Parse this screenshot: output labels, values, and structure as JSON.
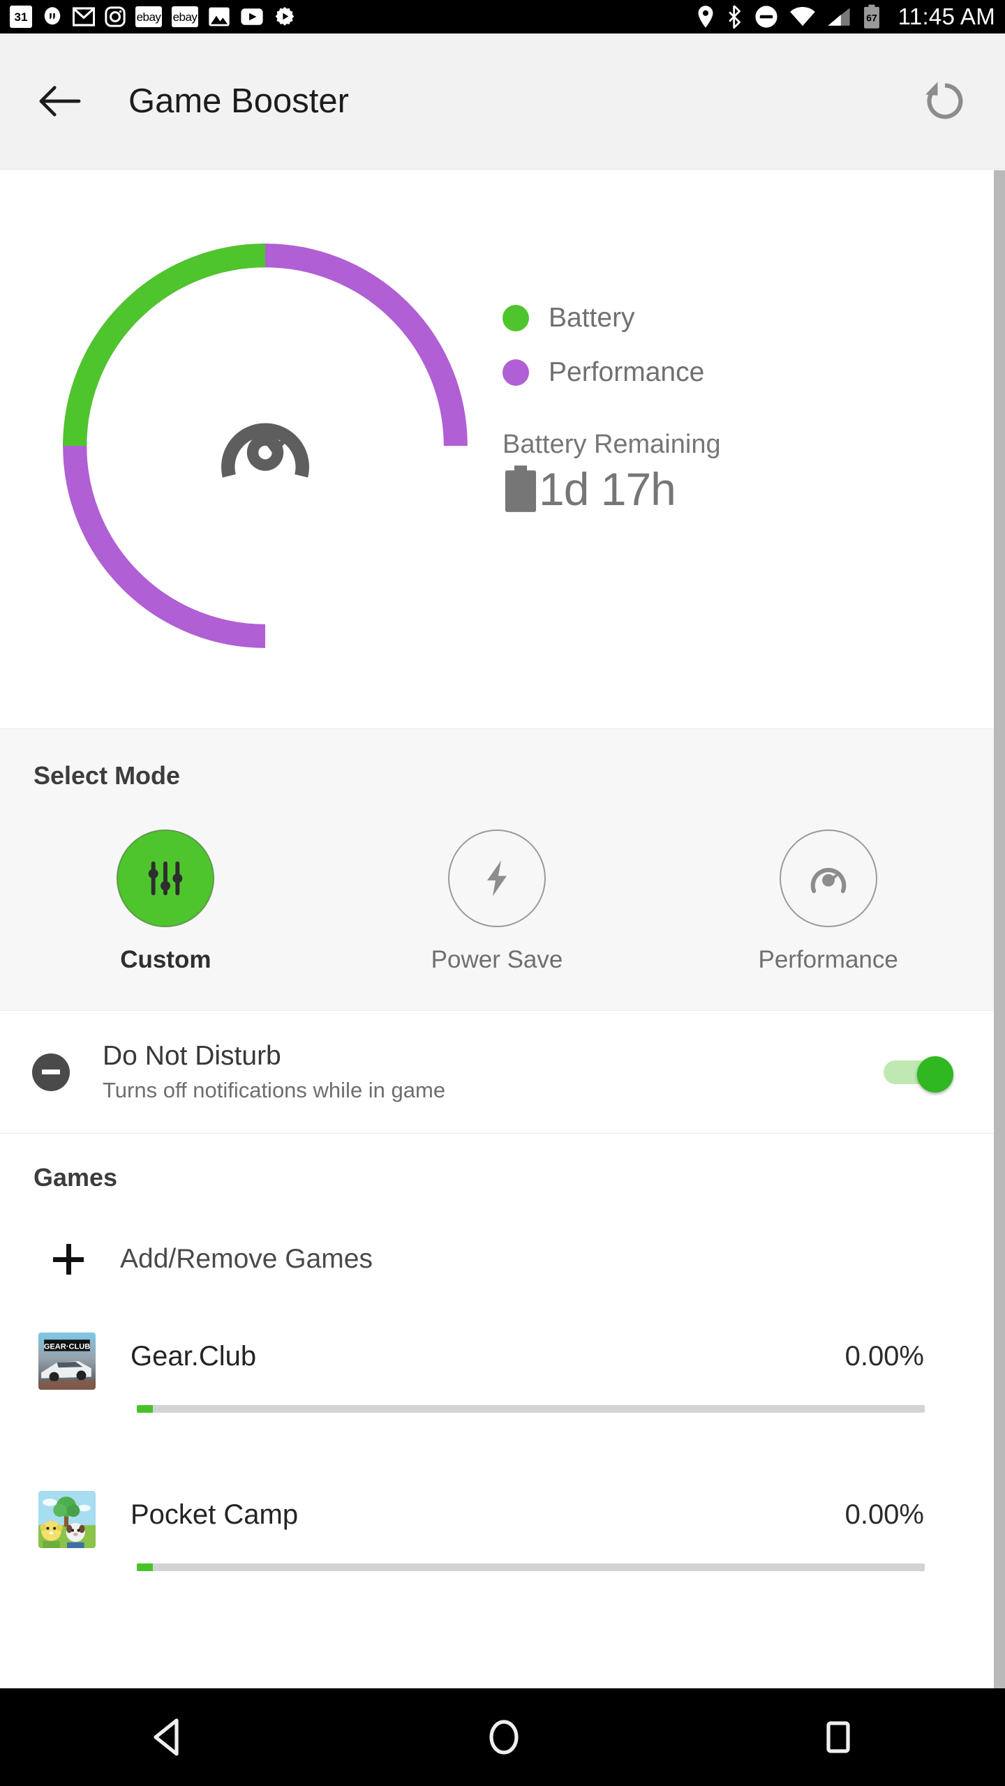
{
  "statusbar": {
    "notification_icons": [
      {
        "name": "calendar-icon",
        "label": "31"
      },
      {
        "name": "hangouts-icon",
        "label": "”"
      },
      {
        "name": "gmail-icon",
        "label": "M"
      },
      {
        "name": "instagram-icon",
        "label": "O"
      },
      {
        "name": "ebay-icon-1",
        "label": "ebay"
      },
      {
        "name": "ebay-icon-2",
        "label": "ebay"
      },
      {
        "name": "photos-icon",
        "label": ""
      },
      {
        "name": "youtube-icon",
        "label": ""
      },
      {
        "name": "settings-gear-icon",
        "label": ""
      }
    ],
    "system_icons": [
      {
        "name": "location-icon"
      },
      {
        "name": "bluetooth-icon"
      },
      {
        "name": "do-not-disturb-icon"
      },
      {
        "name": "wifi-icon"
      },
      {
        "name": "cellular-signal-icon"
      },
      {
        "name": "battery-icon"
      }
    ],
    "battery_level": "67",
    "time": "11:45 AM"
  },
  "appbar": {
    "back_label": "Back",
    "title": "Game Booster",
    "reset_label": "Reset"
  },
  "chart_data": {
    "type": "pie",
    "title": "",
    "subtype": "donut",
    "categories": [
      "Battery",
      "Performance"
    ],
    "values": [
      25,
      75
    ],
    "unit": "%",
    "colors": [
      "#4ec52d",
      "#b05fd4"
    ],
    "legend_position": "right",
    "start_angle": 180,
    "direction": "clockwise",
    "center_icon": "speedometer-icon",
    "annotations": [
      "Battery Remaining",
      "1d 17h"
    ]
  },
  "summary": {
    "legend": [
      {
        "label": "Battery",
        "color": "#4ec52d"
      },
      {
        "label": "Performance",
        "color": "#b05fd4"
      }
    ],
    "battery_remaining_title": "Battery Remaining",
    "battery_remaining_value": "1d 17h"
  },
  "select_mode": {
    "title": "Select Mode",
    "modes": [
      {
        "label": "Custom",
        "icon": "sliders-icon",
        "selected": true
      },
      {
        "label": "Power Save",
        "icon": "lightning-bolt-icon",
        "selected": false
      },
      {
        "label": "Performance",
        "icon": "speedometer-icon",
        "selected": false
      }
    ]
  },
  "do_not_disturb": {
    "icon": "do-not-disturb-icon",
    "title": "Do Not Disturb",
    "subtitle": "Turns off notifications while in game",
    "enabled": true
  },
  "games": {
    "title": "Games",
    "add_remove_label": "Add/Remove Games",
    "items": [
      {
        "name": "Gear.Club",
        "percent": "0.00%",
        "progress": 2,
        "icon": "gear-club-app-icon"
      },
      {
        "name": "Pocket Camp",
        "percent": "0.00%",
        "progress": 2,
        "icon": "pocket-camp-app-icon"
      }
    ]
  },
  "navbar": {
    "back_label": "Back",
    "home_label": "Home",
    "recents_label": "Recents"
  },
  "colors": {
    "accent_green": "#4ec52d",
    "accent_purple": "#b05fd4",
    "appbar_bg": "#f2f2f2",
    "section_bg": "#f7f7f7"
  }
}
